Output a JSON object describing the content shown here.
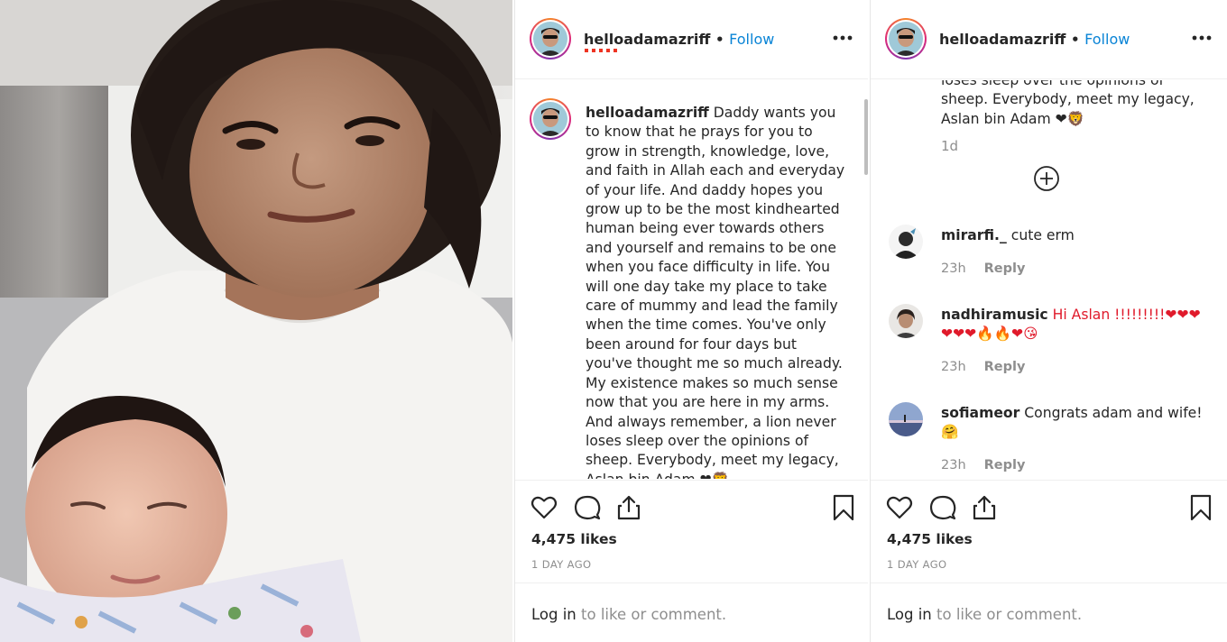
{
  "post": {
    "username": "helloadamazriff",
    "follow_label": "Follow",
    "separator": "•",
    "caption_username": "helloadamazriff",
    "caption_text": "Daddy wants you to know that he prays for you to grow in strength, knowledge, love, and faith in Allah each and everyday of your life. And daddy hopes you grow up to be the most kindhearted human being ever towards others and yourself and remains to be one when you face difficulty in life. You will one day take my place to take care of mummy and lead the family when the time comes. You've only been around for four days but you've thought me so much already. My existence makes so much sense now that you are here in my arms. And always remember, a lion never loses sleep over the opinions of sheep. Everybody, meet my legacy, Aslan bin Adam ❤🦁",
    "caption_tail": "loses sleep over the opinions of sheep. Everybody, meet my legacy, Aslan bin Adam ❤🦁",
    "caption_time": "1d",
    "likes": "4,475 likes",
    "time_ago": "1 DAY AGO",
    "login_link": "Log in",
    "login_rest": " to like or comment."
  },
  "comments": [
    {
      "username": "mirarfi._",
      "text": "cute erm",
      "time": "23h",
      "reply": "Reply"
    },
    {
      "username": "nadhiramusic",
      "text": "Hi Aslan !!!!!!!!!❤❤❤❤❤❤🔥🔥❤😘",
      "time": "23h",
      "reply": "Reply"
    },
    {
      "username": "sofiameor",
      "text": "Congrats adam and wife! 🤗",
      "time": "23h",
      "reply": "Reply"
    }
  ],
  "icons": {
    "like": "heart-icon",
    "comment": "comment-icon",
    "share": "share-icon",
    "save": "bookmark-icon",
    "more": "more-icon",
    "load_more": "plus-circle-icon"
  },
  "colors": {
    "follow": "#0a84d6",
    "muted": "#8e8e8e",
    "text": "#262626",
    "heart": "#e01a2b"
  }
}
